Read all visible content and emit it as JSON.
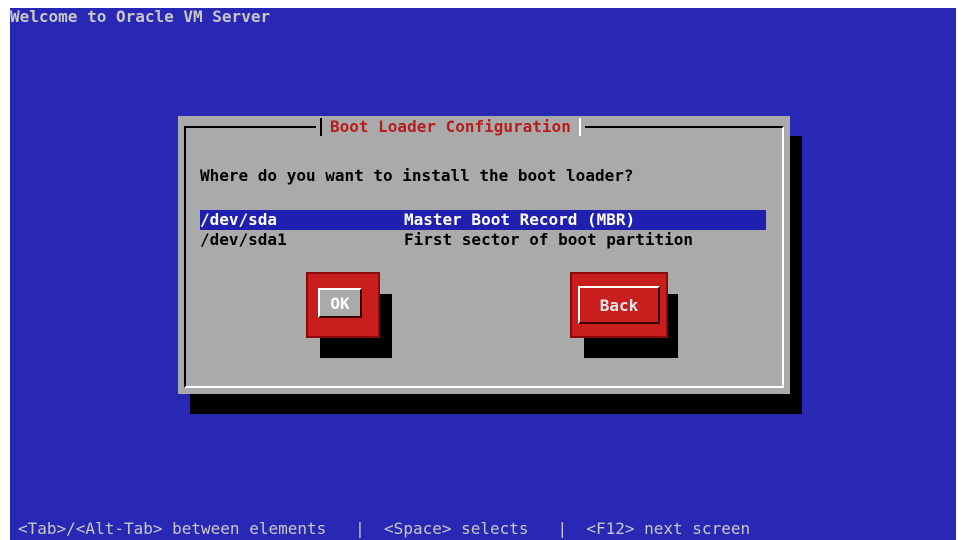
{
  "screen": {
    "title": "Welcome to Oracle VM Server",
    "status": "<Tab>/<Alt-Tab> between elements   |  <Space> selects   |  <F12> next screen"
  },
  "dialog": {
    "title": "Boot Loader Configuration",
    "question": "Where do you want to install the boot loader?",
    "options": [
      {
        "device": "/dev/sda",
        "description": "Master Boot Record (MBR)",
        "selected": true
      },
      {
        "device": "/dev/sda1",
        "description": "First sector of boot partition",
        "selected": false
      }
    ],
    "buttons": {
      "ok": "OK",
      "back": "Back"
    }
  },
  "colors": {
    "background": "#2828b4",
    "dialog": "#aaaaaa",
    "title_text": "#b41e1e",
    "button": "#c81e1e",
    "selection": "#2020b0"
  }
}
